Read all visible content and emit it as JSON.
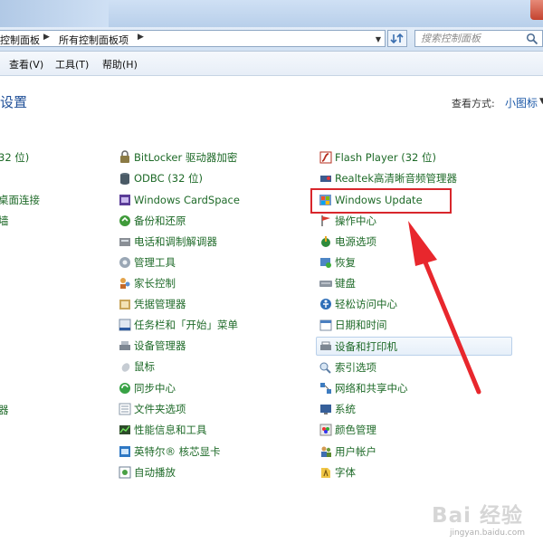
{
  "addressbar": {
    "crumbs": [
      "控制面板",
      "所有控制面板项"
    ],
    "search_placeholder": "搜索控制面板"
  },
  "menubar": {
    "items": [
      "查看(V)",
      "工具(T)",
      "帮助(H)"
    ]
  },
  "header": {
    "title": "设置",
    "viewby_label": "查看方式:",
    "viewby_value": "小图标"
  },
  "columns": {
    "left": [
      "32 位)",
      "桌面连接",
      "墙",
      "器"
    ],
    "middle": [
      {
        "label": "BitLocker 驱动器加密",
        "icon": "bitlocker-icon"
      },
      {
        "label": "ODBC (32 位)",
        "icon": "odbc-icon"
      },
      {
        "label": "Windows CardSpace",
        "icon": "cardspace-icon"
      },
      {
        "label": "备份和还原",
        "icon": "backup-icon"
      },
      {
        "label": "电话和调制解调器",
        "icon": "phone-modem-icon"
      },
      {
        "label": "管理工具",
        "icon": "admin-tools-icon"
      },
      {
        "label": "家长控制",
        "icon": "parental-control-icon"
      },
      {
        "label": "凭据管理器",
        "icon": "credential-icon"
      },
      {
        "label": "任务栏和「开始」菜单",
        "icon": "taskbar-icon"
      },
      {
        "label": "设备管理器",
        "icon": "device-manager-icon"
      },
      {
        "label": "鼠标",
        "icon": "mouse-icon"
      },
      {
        "label": "同步中心",
        "icon": "sync-icon"
      },
      {
        "label": "文件夹选项",
        "icon": "folder-options-icon"
      },
      {
        "label": "性能信息和工具",
        "icon": "performance-icon"
      },
      {
        "label": "英特尔® 核芯显卡",
        "icon": "intel-graphics-icon"
      },
      {
        "label": "自动播放",
        "icon": "autoplay-icon"
      }
    ],
    "right": [
      {
        "label": "Flash Player (32 位)",
        "icon": "flash-icon"
      },
      {
        "label": "Realtek高清晰音频管理器",
        "icon": "realtek-icon"
      },
      {
        "label": "Windows Update",
        "icon": "windows-update-icon"
      },
      {
        "label": "操作中心",
        "icon": "action-center-icon"
      },
      {
        "label": "电源选项",
        "icon": "power-icon"
      },
      {
        "label": "恢复",
        "icon": "recovery-icon"
      },
      {
        "label": "键盘",
        "icon": "keyboard-icon"
      },
      {
        "label": "轻松访问中心",
        "icon": "ease-of-access-icon"
      },
      {
        "label": "日期和时间",
        "icon": "date-time-icon"
      },
      {
        "label": "设备和打印机",
        "icon": "devices-printers-icon"
      },
      {
        "label": "索引选项",
        "icon": "indexing-icon"
      },
      {
        "label": "网络和共享中心",
        "icon": "network-icon"
      },
      {
        "label": "系统",
        "icon": "system-icon"
      },
      {
        "label": "颜色管理",
        "icon": "color-management-icon"
      },
      {
        "label": "用户帐户",
        "icon": "user-accounts-icon"
      },
      {
        "label": "字体",
        "icon": "fonts-icon"
      }
    ]
  },
  "watermark": {
    "text": "Bai 经验",
    "url": "jingyan.baidu.com"
  },
  "colors": {
    "link_green": "#1e6a28",
    "title_blue": "#1e4e97",
    "highlight_red": "#d8262c"
  }
}
